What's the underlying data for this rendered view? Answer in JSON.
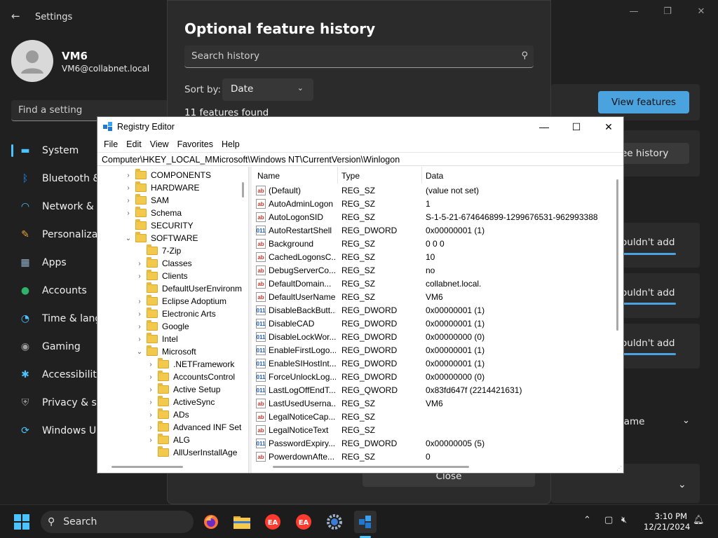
{
  "settings": {
    "app_title": "Settings",
    "user_name": "VM6",
    "user_email": "VM6@collabnet.local",
    "search_placeholder": "Find a setting",
    "nav": [
      {
        "label": "System",
        "icon": "monitor-icon",
        "color": "#4cc2ff"
      },
      {
        "label": "Bluetooth & devices",
        "icon": "bluetooth-icon",
        "color": "#1e90ff"
      },
      {
        "label": "Network & internet",
        "icon": "wifi-icon",
        "color": "#4cc2ff"
      },
      {
        "label": "Personalization",
        "icon": "brush-icon",
        "color": "#e8a33d"
      },
      {
        "label": "Apps",
        "icon": "apps-icon",
        "color": "#8fb0c9"
      },
      {
        "label": "Accounts",
        "icon": "person-icon",
        "color": "#2fb36a"
      },
      {
        "label": "Time & language",
        "icon": "clock-globe-icon",
        "color": "#4cc2ff"
      },
      {
        "label": "Gaming",
        "icon": "gamepad-icon",
        "color": "#a0a0a0"
      },
      {
        "label": "Accessibility",
        "icon": "accessibility-icon",
        "color": "#4cc2ff"
      },
      {
        "label": "Privacy & security",
        "icon": "shield-icon",
        "color": "#9a9a9a"
      },
      {
        "label": "Windows Update",
        "icon": "update-icon",
        "color": "#4cc2ff"
      }
    ],
    "view_features_label": "View features",
    "see_history_label": "ee history",
    "couldnt_add_label": "ouldn't add",
    "sort_name_label": "lame"
  },
  "dialog": {
    "title": "Optional feature history",
    "search_placeholder": "Search history",
    "sort_label": "Sort by:",
    "sort_value": "Date",
    "found_count": "11 features found",
    "close_label": "Close"
  },
  "regedit": {
    "title": "Registry Editor",
    "menus": [
      "File",
      "Edit",
      "View",
      "Favorites",
      "Help"
    ],
    "address": "Computer\\HKEY_LOCAL_MMicrosoft\\Windows NT\\CurrentVersion\\Winlogon",
    "tree": [
      {
        "label": "COMPONENTS",
        "level": 0,
        "chev": "›"
      },
      {
        "label": "HARDWARE",
        "level": 0,
        "chev": "›"
      },
      {
        "label": "SAM",
        "level": 0,
        "chev": "›"
      },
      {
        "label": "Schema",
        "level": 0,
        "chev": "›"
      },
      {
        "label": "SECURITY",
        "level": 0,
        "chev": ""
      },
      {
        "label": "SOFTWARE",
        "level": 0,
        "chev": "⌄"
      },
      {
        "label": "7-Zip",
        "level": 1,
        "chev": ""
      },
      {
        "label": "Classes",
        "level": 1,
        "chev": "›"
      },
      {
        "label": "Clients",
        "level": 1,
        "chev": "›"
      },
      {
        "label": "DefaultUserEnvironm",
        "level": 1,
        "chev": ""
      },
      {
        "label": "Eclipse Adoptium",
        "level": 1,
        "chev": "›"
      },
      {
        "label": "Electronic Arts",
        "level": 1,
        "chev": "›"
      },
      {
        "label": "Google",
        "level": 1,
        "chev": "›"
      },
      {
        "label": "Intel",
        "level": 1,
        "chev": "›"
      },
      {
        "label": "Microsoft",
        "level": 1,
        "chev": "⌄"
      },
      {
        "label": ".NETFramework",
        "level": 2,
        "chev": "›"
      },
      {
        "label": "AccountsControl",
        "level": 2,
        "chev": "›"
      },
      {
        "label": "Active Setup",
        "level": 2,
        "chev": "›"
      },
      {
        "label": "ActiveSync",
        "level": 2,
        "chev": "›"
      },
      {
        "label": "ADs",
        "level": 2,
        "chev": "›"
      },
      {
        "label": "Advanced INF Set",
        "level": 2,
        "chev": "›"
      },
      {
        "label": "ALG",
        "level": 2,
        "chev": "›"
      },
      {
        "label": "AllUserInstallAge",
        "level": 2,
        "chev": ""
      }
    ],
    "columns": {
      "name": "Name",
      "type": "Type",
      "data": "Data"
    },
    "values": [
      {
        "name": "(Default)",
        "type": "REG_SZ",
        "data": "(value not set)",
        "kind": "sz"
      },
      {
        "name": "AutoAdminLogon",
        "type": "REG_SZ",
        "data": "1",
        "kind": "sz"
      },
      {
        "name": "AutoLogonSID",
        "type": "REG_SZ",
        "data": "S-1-5-21-674646899-1299676531-962993388",
        "kind": "sz"
      },
      {
        "name": "AutoRestartShell",
        "type": "REG_DWORD",
        "data": "0x00000001 (1)",
        "kind": "dw"
      },
      {
        "name": "Background",
        "type": "REG_SZ",
        "data": "0 0 0",
        "kind": "sz"
      },
      {
        "name": "CachedLogonsC...",
        "type": "REG_SZ",
        "data": "10",
        "kind": "sz"
      },
      {
        "name": "DebugServerCo...",
        "type": "REG_SZ",
        "data": "no",
        "kind": "sz"
      },
      {
        "name": "DefaultDomain...",
        "type": "REG_SZ",
        "data": "collabnet.local.",
        "kind": "sz"
      },
      {
        "name": "DefaultUserName",
        "type": "REG_SZ",
        "data": "VM6",
        "kind": "sz"
      },
      {
        "name": "DisableBackButt...",
        "type": "REG_DWORD",
        "data": "0x00000001 (1)",
        "kind": "dw"
      },
      {
        "name": "DisableCAD",
        "type": "REG_DWORD",
        "data": "0x00000001 (1)",
        "kind": "dw"
      },
      {
        "name": "DisableLockWor...",
        "type": "REG_DWORD",
        "data": "0x00000000 (0)",
        "kind": "dw"
      },
      {
        "name": "EnableFirstLogo...",
        "type": "REG_DWORD",
        "data": "0x00000001 (1)",
        "kind": "dw"
      },
      {
        "name": "EnableSIHostInt...",
        "type": "REG_DWORD",
        "data": "0x00000001 (1)",
        "kind": "dw"
      },
      {
        "name": "ForceUnlockLog...",
        "type": "REG_DWORD",
        "data": "0x00000000 (0)",
        "kind": "dw"
      },
      {
        "name": "LastLogOffEndT...",
        "type": "REG_QWORD",
        "data": "0x83fd647f (2214421631)",
        "kind": "dw"
      },
      {
        "name": "LastUsedUserna...",
        "type": "REG_SZ",
        "data": "VM6",
        "kind": "sz"
      },
      {
        "name": "LegalNoticeCap...",
        "type": "REG_SZ",
        "data": "",
        "kind": "sz"
      },
      {
        "name": "LegalNoticeText",
        "type": "REG_SZ",
        "data": "",
        "kind": "sz"
      },
      {
        "name": "PasswordExpiry...",
        "type": "REG_DWORD",
        "data": "0x00000005 (5)",
        "kind": "dw"
      },
      {
        "name": "PowerdownAfte...",
        "type": "REG_SZ",
        "data": "0",
        "kind": "sz"
      }
    ],
    "icon_text": {
      "sz": "ab",
      "dw": "011"
    }
  },
  "taskbar": {
    "search_label": "Search",
    "time": "3:10 PM",
    "date": "12/21/2024",
    "apps": [
      "firefox-icon",
      "file-explorer-icon",
      "ea-icon",
      "ea-icon",
      "settings-gear-icon",
      "regedit-icon"
    ]
  }
}
